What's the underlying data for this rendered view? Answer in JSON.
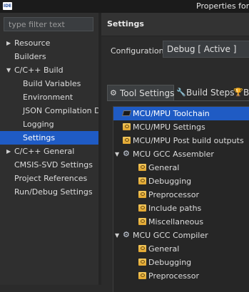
{
  "window": {
    "app_icon_text": "IDE",
    "title": "Properties for H"
  },
  "left": {
    "filter_placeholder": "type filter text",
    "items": [
      {
        "label": "Resource",
        "level": 0,
        "arrow": "▶"
      },
      {
        "label": "Builders",
        "level": 0,
        "arrow": ""
      },
      {
        "label": "C/C++ Build",
        "level": 0,
        "arrow": "▼"
      },
      {
        "label": "Build Variables",
        "level": 1,
        "arrow": ""
      },
      {
        "label": "Environment",
        "level": 1,
        "arrow": ""
      },
      {
        "label": "JSON Compilation Dat",
        "level": 1,
        "arrow": ""
      },
      {
        "label": "Logging",
        "level": 1,
        "arrow": ""
      },
      {
        "label": "Settings",
        "level": 1,
        "arrow": "",
        "selected": true
      },
      {
        "label": "C/C++ General",
        "level": 0,
        "arrow": "▶"
      },
      {
        "label": "CMSIS-SVD Settings",
        "level": 0,
        "arrow": ""
      },
      {
        "label": "Project References",
        "level": 0,
        "arrow": ""
      },
      {
        "label": "Run/Debug Settings",
        "level": 0,
        "arrow": ""
      }
    ]
  },
  "right": {
    "title": "Settings",
    "configuration_label": "Configuration:",
    "configuration_value": "Debug  [ Active ]",
    "tabs": [
      {
        "label": "Tool Settings",
        "icon": "gear-icon",
        "active": true
      },
      {
        "label": "Build Steps",
        "icon": "wrench-icon",
        "active": false
      },
      {
        "label": "Bu",
        "icon": "trophy-icon",
        "active": false
      }
    ],
    "tool_tree": [
      {
        "label": "MCU/MPU Toolchain",
        "indent": 0,
        "icon": "chip-icon",
        "expander": "",
        "selected": true
      },
      {
        "label": "MCU/MPU Settings",
        "indent": 0,
        "icon": "folder-gear-icon",
        "expander": ""
      },
      {
        "label": "MCU/MPU Post build outputs",
        "indent": 0,
        "icon": "folder-gear-icon",
        "expander": ""
      },
      {
        "label": "MCU GCC Assembler",
        "indent": 0,
        "icon": "gear-icon",
        "expander": "▼"
      },
      {
        "label": "General",
        "indent": 1,
        "icon": "folder-gear-icon",
        "expander": ""
      },
      {
        "label": "Debugging",
        "indent": 1,
        "icon": "folder-gear-icon",
        "expander": ""
      },
      {
        "label": "Preprocessor",
        "indent": 1,
        "icon": "folder-gear-icon",
        "expander": ""
      },
      {
        "label": "Include paths",
        "indent": 1,
        "icon": "folder-gear-icon",
        "expander": ""
      },
      {
        "label": "Miscellaneous",
        "indent": 1,
        "icon": "folder-gear-icon",
        "expander": ""
      },
      {
        "label": "MCU GCC Compiler",
        "indent": 0,
        "icon": "gear-icon",
        "expander": "▼"
      },
      {
        "label": "General",
        "indent": 1,
        "icon": "folder-gear-icon",
        "expander": ""
      },
      {
        "label": "Debugging",
        "indent": 1,
        "icon": "folder-gear-icon",
        "expander": ""
      },
      {
        "label": "Preprocessor",
        "indent": 1,
        "icon": "folder-gear-icon",
        "expander": ""
      }
    ]
  }
}
